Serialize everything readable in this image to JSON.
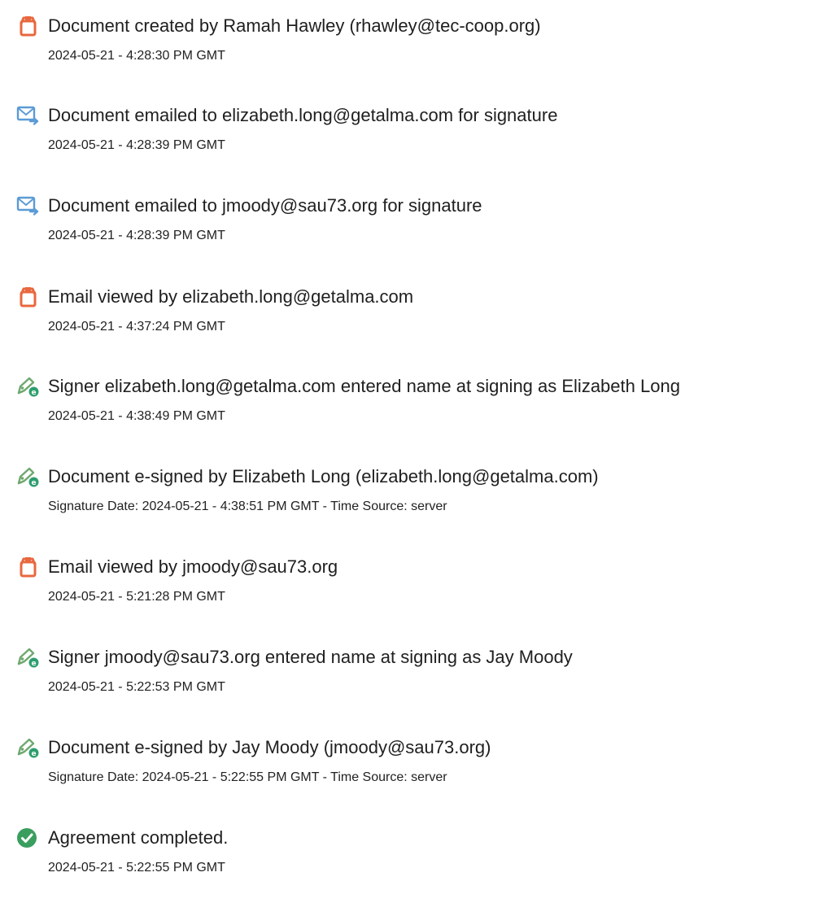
{
  "events": [
    {
      "icon": "document-icon",
      "title": "Document created by Ramah Hawley (rhawley@tec-coop.org)",
      "time": "2024-05-21 - 4:28:30 PM GMT"
    },
    {
      "icon": "email-sent-icon",
      "title": "Document emailed to elizabeth.long@getalma.com for signature",
      "time": "2024-05-21 - 4:28:39 PM GMT"
    },
    {
      "icon": "email-sent-icon",
      "title": "Document emailed to jmoody@sau73.org for signature",
      "time": "2024-05-21 - 4:28:39 PM GMT"
    },
    {
      "icon": "document-icon",
      "title": "Email viewed by elizabeth.long@getalma.com",
      "time": "2024-05-21 - 4:37:24 PM GMT"
    },
    {
      "icon": "esign-pen-icon",
      "title": "Signer elizabeth.long@getalma.com entered name at signing as Elizabeth Long",
      "time": "2024-05-21 - 4:38:49 PM GMT"
    },
    {
      "icon": "esign-pen-icon",
      "title": "Document e-signed by Elizabeth Long (elizabeth.long@getalma.com)",
      "time": "Signature Date: 2024-05-21 - 4:38:51 PM GMT - Time Source: server"
    },
    {
      "icon": "document-icon",
      "title": "Email viewed by jmoody@sau73.org",
      "time": "2024-05-21 - 5:21:28 PM GMT"
    },
    {
      "icon": "esign-pen-icon",
      "title": "Signer jmoody@sau73.org entered name at signing as Jay Moody",
      "time": "2024-05-21 - 5:22:53 PM GMT"
    },
    {
      "icon": "esign-pen-icon",
      "title": "Document e-signed by Jay Moody (jmoody@sau73.org)",
      "time": "Signature Date: 2024-05-21 - 5:22:55 PM GMT - Time Source: server"
    },
    {
      "icon": "check-circle-icon",
      "title": "Agreement completed.",
      "time": "2024-05-21 - 5:22:55 PM GMT"
    }
  ],
  "colors": {
    "document_icon": "#e8683f",
    "email_icon": "#5b9bd5",
    "pen_icon": "#6fa86f",
    "pen_badge": "#2e9e6e",
    "check_icon": "#3a9e5f",
    "title_text": "#1f1f1f",
    "time_text": "#222222"
  }
}
